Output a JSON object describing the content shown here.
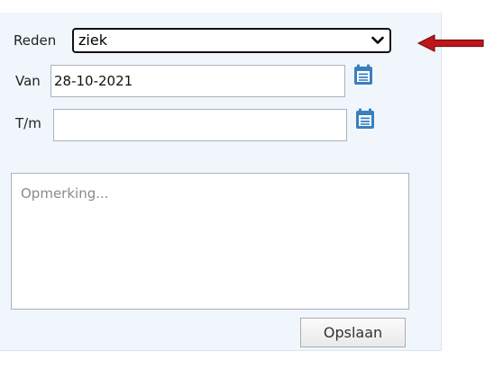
{
  "form": {
    "reason_label": "Reden",
    "reason_value": "ziek",
    "from_label": "Van",
    "from_value": "28-10-2021",
    "to_label": "T/m",
    "to_value": "",
    "remark_placeholder": "Opmerking...",
    "save_label": "Opslaan"
  },
  "icons": {
    "calendar": "calendar-icon",
    "chevron": "chevron-down-icon",
    "annotation_arrow": "arrow-left-icon"
  },
  "colors": {
    "panel_bg": "#f0f6fb",
    "icon_blue": "#3a7fc0",
    "arrow_red": "#c0161b"
  }
}
